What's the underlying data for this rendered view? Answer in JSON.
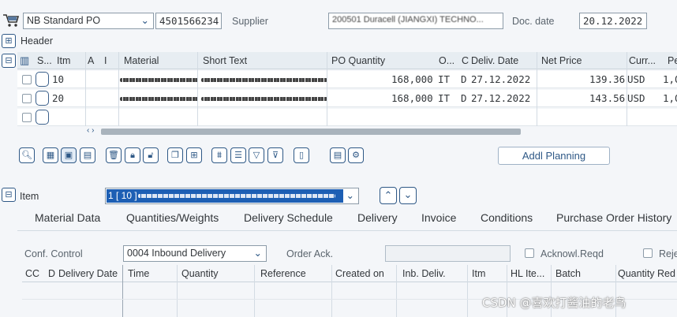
{
  "top": {
    "doc_type": "NB Standard PO",
    "po_number": "4501566234",
    "supplier_label": "Supplier",
    "supplier_value": "200501 Duracell (JIANGXI) TECHNO...",
    "doc_date_label": "Doc. date",
    "doc_date_value": "20.12.2022"
  },
  "header_section": {
    "label": "Header"
  },
  "items_table": {
    "columns": [
      "S...",
      "Itm",
      "A",
      "I",
      "Material",
      "Short Text",
      "PO Quantity",
      "O...",
      "C",
      "Deliv. Date",
      "Net Price",
      "Curr...",
      "Pe"
    ],
    "rows": [
      {
        "itm": "10",
        "po_qty": "168,000",
        "o": "IT",
        "c": "D",
        "deliv_date": "27.12.2022",
        "net_price": "139.36",
        "curr": "USD",
        "pe": "1,0"
      },
      {
        "itm": "20",
        "po_qty": "168,000",
        "o": "IT",
        "c": "D",
        "deliv_date": "27.12.2022",
        "net_price": "143.56",
        "curr": "USD",
        "pe": "1,0"
      }
    ],
    "scroll_arrows": "‹ ›"
  },
  "toolbar": {
    "addl_planning": "Addl Planning"
  },
  "item_section": {
    "label": "Item",
    "selected_item": "1 [ 10 ]"
  },
  "tabs": [
    "Material Data",
    "Quantities/Weights",
    "Delivery Schedule",
    "Delivery",
    "Invoice",
    "Conditions",
    "Purchase Order History"
  ],
  "conf": {
    "label": "Conf. Control",
    "value": "0004 Inbound Delivery",
    "order_ack_label": "Order Ack.",
    "ackn_reqd_label": "Acknowl.Reqd",
    "rejected_label": "Reje"
  },
  "conf_grid_columns": [
    "CC",
    "D",
    "Delivery Date",
    "Time",
    "Quantity",
    "Reference",
    "Created on",
    "Inb. Deliv.",
    "Itm",
    "HL Ite...",
    "Batch",
    "Quantity Red"
  ],
  "watermark": "CSDN @喜欢打酱油的老鸟",
  "colors": {
    "accent": "#2e5886",
    "header_bg": "#e7edf2",
    "selected_item_bg": "#1d5fb4"
  }
}
